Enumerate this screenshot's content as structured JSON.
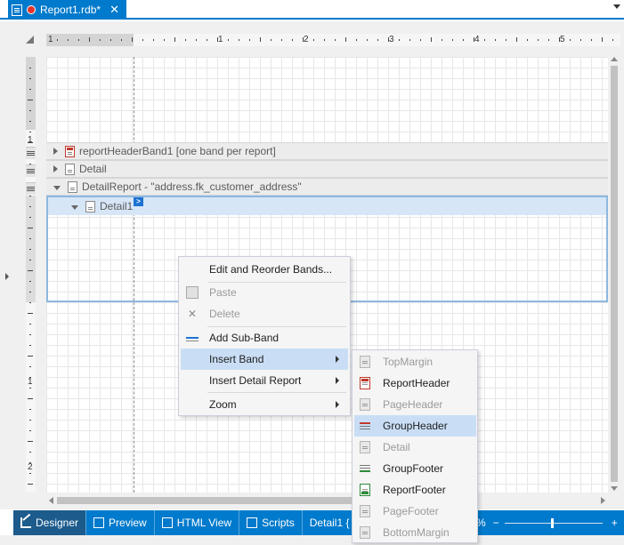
{
  "tab": {
    "title": "Report1.rdb*",
    "close": "✕"
  },
  "ruler": {
    "h_numbers": [
      "1",
      "1",
      "2",
      "3",
      "4",
      "5"
    ],
    "v_numbers": [
      "1",
      "1",
      "2"
    ]
  },
  "bands": {
    "report_header": "reportHeaderBand1 [one band per report]",
    "detail": "Detail",
    "detail_report": "DetailReport - \"address.fk_customer_address\"",
    "detail1": "Detail1",
    "smart_tag": ">"
  },
  "context_menu": {
    "items": [
      {
        "label": "Edit and Reorder Bands...",
        "disabled": false,
        "icon": ""
      },
      {
        "label": "Paste",
        "disabled": true,
        "icon": "paste-icon"
      },
      {
        "label": "Delete",
        "disabled": true,
        "icon": "delete-icon"
      },
      {
        "label": "Add Sub-Band",
        "disabled": false,
        "icon": "sub-band-icon"
      },
      {
        "label": "Insert Band",
        "disabled": false,
        "icon": "",
        "submenu": true,
        "highlighted": true
      },
      {
        "label": "Insert Detail Report",
        "disabled": false,
        "icon": "",
        "submenu": true
      },
      {
        "label": "Zoom",
        "disabled": false,
        "icon": "",
        "submenu": true
      }
    ]
  },
  "insert_band_menu": {
    "items": [
      {
        "label": "TopMargin",
        "disabled": true
      },
      {
        "label": "ReportHeader",
        "disabled": false
      },
      {
        "label": "PageHeader",
        "disabled": true
      },
      {
        "label": "GroupHeader",
        "disabled": false,
        "highlighted": true
      },
      {
        "label": "Detail",
        "disabled": true
      },
      {
        "label": "GroupFooter",
        "disabled": false
      },
      {
        "label": "ReportFooter",
        "disabled": false
      },
      {
        "label": "PageFooter",
        "disabled": true
      },
      {
        "label": "BottomMargin",
        "disabled": true
      }
    ]
  },
  "statusbar": {
    "designer": "Designer",
    "preview": "Preview",
    "html_view": "HTML View",
    "scripts": "Scripts",
    "breadcrumb": "Detail1 {",
    "zoom_fragment": "%",
    "zoom_minus": "−",
    "zoom_plus": "+"
  },
  "colors": {
    "accent": "#007acc",
    "highlight": "#c9def5",
    "selected_band": "#d7e6f7"
  }
}
